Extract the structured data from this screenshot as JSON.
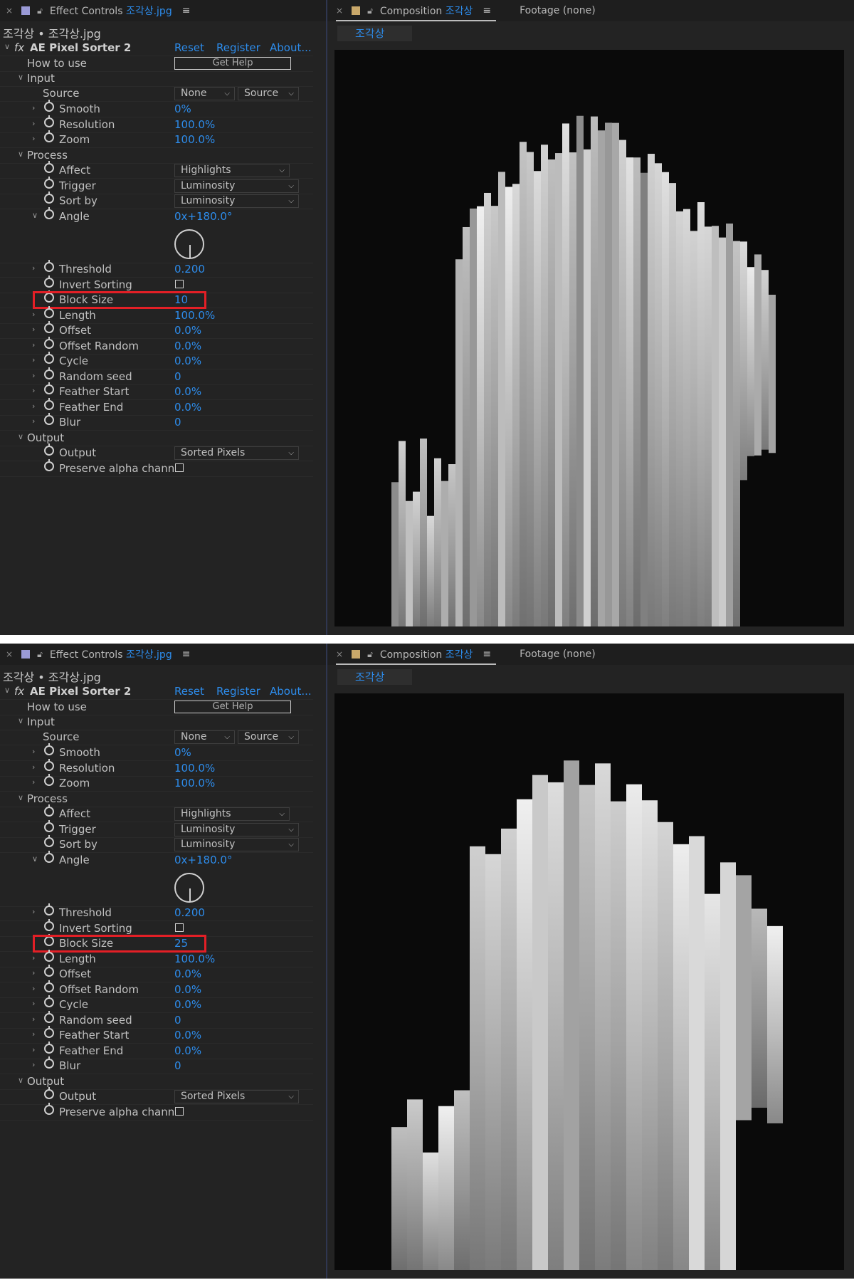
{
  "effect_panel": {
    "tab_close": "×",
    "tab_label": "Effect Controls",
    "tab_file": "조각상.jpg",
    "breadcrumb": "조각상 • 조각상.jpg",
    "effect_name": "AE Pixel Sorter 2",
    "fx_icon": "fx",
    "reset": "Reset",
    "register": "Register",
    "about": "About...",
    "how_to_use": "How to use",
    "get_help": "Get Help",
    "group_input": "Input",
    "source_label": "Source",
    "source_value": "None",
    "source_value2": "Source",
    "smooth_label": "Smooth",
    "smooth_value": "0%",
    "resolution_label": "Resolution",
    "resolution_value": "100.0%",
    "zoom_label": "Zoom",
    "zoom_value": "100.0%",
    "group_process": "Process",
    "affect_label": "Affect",
    "affect_value": "Highlights",
    "trigger_label": "Trigger",
    "trigger_value": "Luminosity",
    "sortby_label": "Sort by",
    "sortby_value": "Luminosity",
    "angle_label": "Angle",
    "angle_value": "0x+180.0°",
    "threshold_label": "Threshold",
    "threshold_value": "0.200",
    "invert_label": "Invert Sorting",
    "blocksize_label": "Block Size",
    "length_label": "Length",
    "length_value": "100.0%",
    "offset_label": "Offset",
    "offset_value": "0.0%",
    "offsetrandom_label": "Offset Random",
    "offsetrandom_value": "0.0%",
    "cycle_label": "Cycle",
    "cycle_value": "0.0%",
    "randomseed_label": "Random seed",
    "randomseed_value": "0",
    "featherstart_label": "Feather Start",
    "featherstart_value": "0.0%",
    "featherend_label": "Feather End",
    "featherend_value": "0.0%",
    "blur_label": "Blur",
    "blur_value": "0",
    "group_output": "Output",
    "output_label": "Output",
    "output_value": "Sorted Pixels",
    "preserve_label": "Preserve alpha chann"
  },
  "comp_panel": {
    "tab_close": "×",
    "tab_label": "Composition",
    "tab_name": "조각상",
    "footage": "Footage",
    "footage_value": "(none)",
    "comp_tab": "조각상"
  },
  "screens": [
    {
      "block_size": "10"
    },
    {
      "block_size": "25"
    }
  ],
  "colors": {
    "accent_blue": "#2d8ceb",
    "highlight_red": "#e31f26",
    "panel_bg": "#232323",
    "viewer_bg": "#0a0a0a"
  }
}
